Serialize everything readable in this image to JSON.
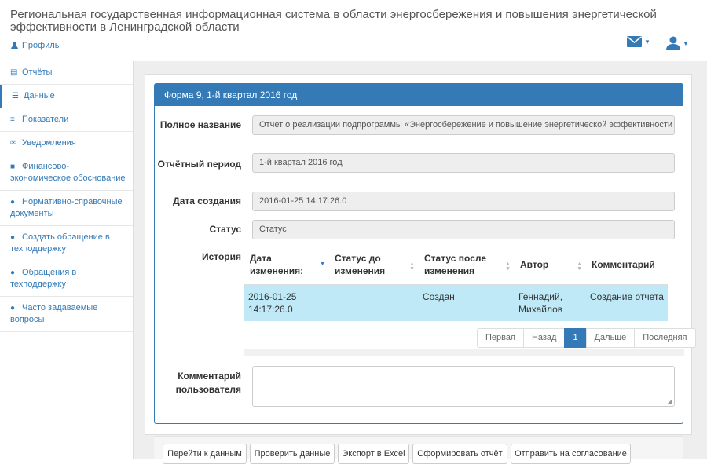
{
  "header": {
    "title": "Региональная государственная информационная система в области энергосбережения и повышения энергетической эффективности в Ленинградской области",
    "profile_label": "Профиль",
    "mail_icon": "envelope-icon",
    "user_icon": "user-icon"
  },
  "sidebar": {
    "items": [
      {
        "label": "Отчёты",
        "icon": "file-icon"
      },
      {
        "label": "Данные",
        "icon": "database-icon"
      },
      {
        "label": "Показатели",
        "icon": "sliders-icon"
      },
      {
        "label": "Уведомления",
        "icon": "envelope-icon"
      },
      {
        "label": "Финансово-экономическое обоснование",
        "icon": "briefcase-icon"
      },
      {
        "label": "Нормативно-справочные документы",
        "icon": "info-icon"
      },
      {
        "label": "Создать обращение в техподдержку",
        "icon": "comments-icon"
      },
      {
        "label": "Обращения в техподдержку",
        "icon": "comments-icon"
      },
      {
        "label": "Часто задаваемые вопросы",
        "icon": "comments-icon"
      }
    ]
  },
  "form": {
    "heading": "Форма 9, 1-й квартал 2016 год",
    "full_name_label": "Полное название",
    "full_name_value": "Отчет о реализации подпрограммы «Энергосбережение и повышение энергетической эффективности на т",
    "period_label": "Отчётный период",
    "period_value": "1-й квартал 2016 год",
    "created_label": "Дата создания",
    "created_value": "2016-01-25 14:17:26.0",
    "status_label": "Статус",
    "status_placeholder": "Статус",
    "history_label": "История",
    "comment_label": "Комментарий пользователя"
  },
  "history": {
    "columns": [
      "Дата изменения:",
      "Статус до изменения",
      "Статус после изменения",
      "Автор",
      "Комментарий"
    ],
    "rows": [
      {
        "date": "2016-01-25 14:17:26.0",
        "status_before": "",
        "status_after": "Создан",
        "author": "Геннадий, Михайлов",
        "comment": "Создание отчета"
      }
    ]
  },
  "pager": {
    "first": "Первая",
    "prev": "Назад",
    "current": "1",
    "next": "Дальше",
    "last": "Последняя"
  },
  "buttons": {
    "goto_data": "Перейти к данным",
    "check_data": "Проверить данные",
    "export_excel": "Экспорт в Excel",
    "build_report": "Сформировать отчёт",
    "send_approval": "Отправить на согласование"
  },
  "colors": {
    "primary": "#337ab7",
    "row_highlight": "#bfe9f6"
  }
}
